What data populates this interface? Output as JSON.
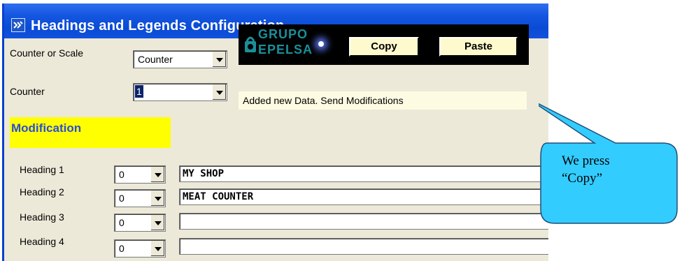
{
  "window": {
    "title": "Headings and Legends Configuration",
    "title_icon": "app-icon"
  },
  "controls": {
    "counter_or_scale_label": "Counter or Scale",
    "counter_or_scale_value": "Counter",
    "counter_label": "Counter",
    "counter_value": "1"
  },
  "logo": {
    "line1": "GRUPO",
    "line2": "EPELSA"
  },
  "buttons": {
    "copy": "Copy",
    "paste": "Paste"
  },
  "status": "Added new Data. Send Modifications",
  "section_title": "Modification",
  "headings": [
    {
      "label": "Heading 1",
      "number": "0",
      "text": "MY SHOP"
    },
    {
      "label": "Heading 2",
      "number": "0",
      "text": "MEAT COUNTER"
    },
    {
      "label": "Heading 3",
      "number": "0",
      "text": ""
    },
    {
      "label": "Heading 4",
      "number": "0",
      "text": ""
    }
  ],
  "callout": {
    "line1": "We press",
    "line2": "“Copy”"
  },
  "colors": {
    "titlebar": "#0a4bd6",
    "window_bg": "#ece9d8",
    "modification_bg": "#ffff00",
    "modification_text": "#2a4dd8",
    "button_bg": "#fffacd",
    "callout_fill": "#33ccff"
  }
}
